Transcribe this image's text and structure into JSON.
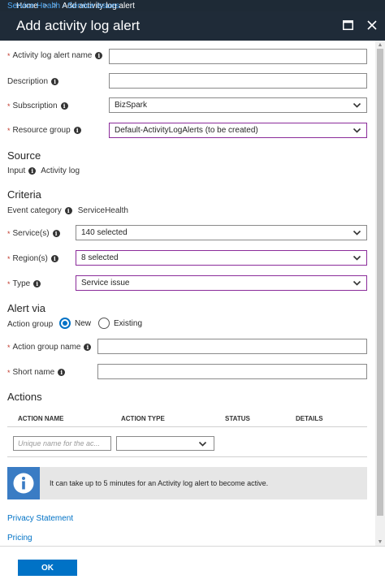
{
  "breadcrumb": {
    "home": "Home",
    "service_health": "Service Health - Service issues",
    "separator": ">",
    "current": "Add activity log alert"
  },
  "title": "Add activity log alert",
  "form": {
    "alert_name": {
      "label": "Activity log alert name",
      "value": ""
    },
    "description": {
      "label": "Description",
      "value": ""
    },
    "subscription": {
      "label": "Subscription",
      "value": "BizSpark"
    },
    "resource_group": {
      "label": "Resource group",
      "value": "Default-ActivityLogAlerts (to be created)"
    }
  },
  "source": {
    "heading": "Source",
    "input_label": "Input",
    "input_value": "Activity log"
  },
  "criteria": {
    "heading": "Criteria",
    "event_category_label": "Event category",
    "event_category_value": "ServiceHealth",
    "services": {
      "label": "Service(s)",
      "value": "140 selected"
    },
    "regions": {
      "label": "Region(s)",
      "value": "8 selected"
    },
    "type": {
      "label": "Type",
      "value": "Service issue"
    }
  },
  "alert_via": {
    "heading": "Alert via",
    "action_group_label": "Action group",
    "option_new": "New",
    "option_existing": "Existing",
    "action_group_name": {
      "label": "Action group name",
      "value": ""
    },
    "short_name": {
      "label": "Short name",
      "value": ""
    }
  },
  "actions": {
    "heading": "Actions",
    "columns": [
      "ACTION NAME",
      "ACTION TYPE",
      "STATUS",
      "DETAILS"
    ],
    "name_placeholder": "Unique name for the ac..."
  },
  "info_message": "It can take up to 5 minutes for an Activity log alert to become active.",
  "links": {
    "privacy": "Privacy Statement",
    "pricing": "Pricing"
  },
  "footer": {
    "ok_label": "OK"
  },
  "colors": {
    "accent": "#0072c6",
    "header_bg": "#1f2b38",
    "focus_border": "#8b2c9a",
    "required": "#c0392b"
  }
}
